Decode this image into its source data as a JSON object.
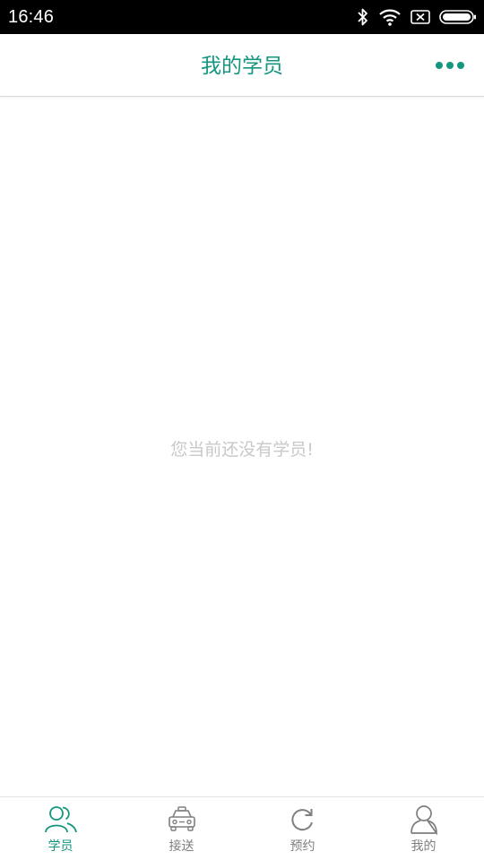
{
  "status_bar": {
    "time": "16:46",
    "icons": [
      "bluetooth-icon",
      "wifi-icon",
      "sim-off-icon",
      "battery-icon"
    ]
  },
  "header": {
    "title": "我的学员",
    "more_icon": "more-dots-icon"
  },
  "main": {
    "empty_message": "您当前还没有学员!"
  },
  "bottom_nav": {
    "items": [
      {
        "label": "学员",
        "icon": "students-icon",
        "active": true
      },
      {
        "label": "接送",
        "icon": "car-icon",
        "active": false
      },
      {
        "label": "预约",
        "icon": "refresh-icon",
        "active": false
      },
      {
        "label": "我的",
        "icon": "profile-icon",
        "active": false
      }
    ]
  },
  "colors": {
    "accent": "#14967f",
    "inactive": "#7f7f7f",
    "empty_text": "#c8c8c8",
    "status_bar": "#000000"
  }
}
